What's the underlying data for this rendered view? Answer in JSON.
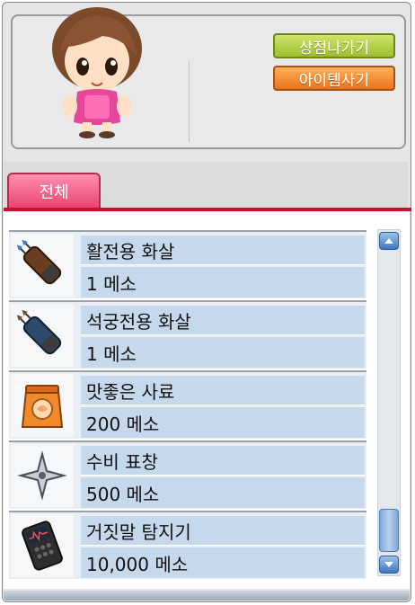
{
  "npc": {
    "icon": "shopkeeper-npc"
  },
  "buttons": {
    "exit_shop_label": "상점나가기",
    "buy_item_label": "아이템사기"
  },
  "tabs": [
    {
      "label": "전체",
      "selected": true
    }
  ],
  "items": [
    {
      "name": "활전용 화살",
      "price": "1 메소",
      "icon": "bow-arrows-icon"
    },
    {
      "name": "석궁전용 화살",
      "price": "1 메소",
      "icon": "crossbow-arrows-icon"
    },
    {
      "name": "맛좋은 사료",
      "price": "200 메소",
      "icon": "pet-food-icon"
    },
    {
      "name": "수비 표창",
      "price": "500 메소",
      "icon": "throwing-star-icon"
    },
    {
      "name": "거짓말 탐지기",
      "price": "10,000 메소",
      "icon": "lie-detector-icon"
    }
  ],
  "colors": {
    "tab_accent": "#e8436e",
    "divider_red": "#c8102e",
    "row_background": "#c6d9ec",
    "exit_button": "#9fbd2e",
    "buy_button": "#e8731c"
  }
}
